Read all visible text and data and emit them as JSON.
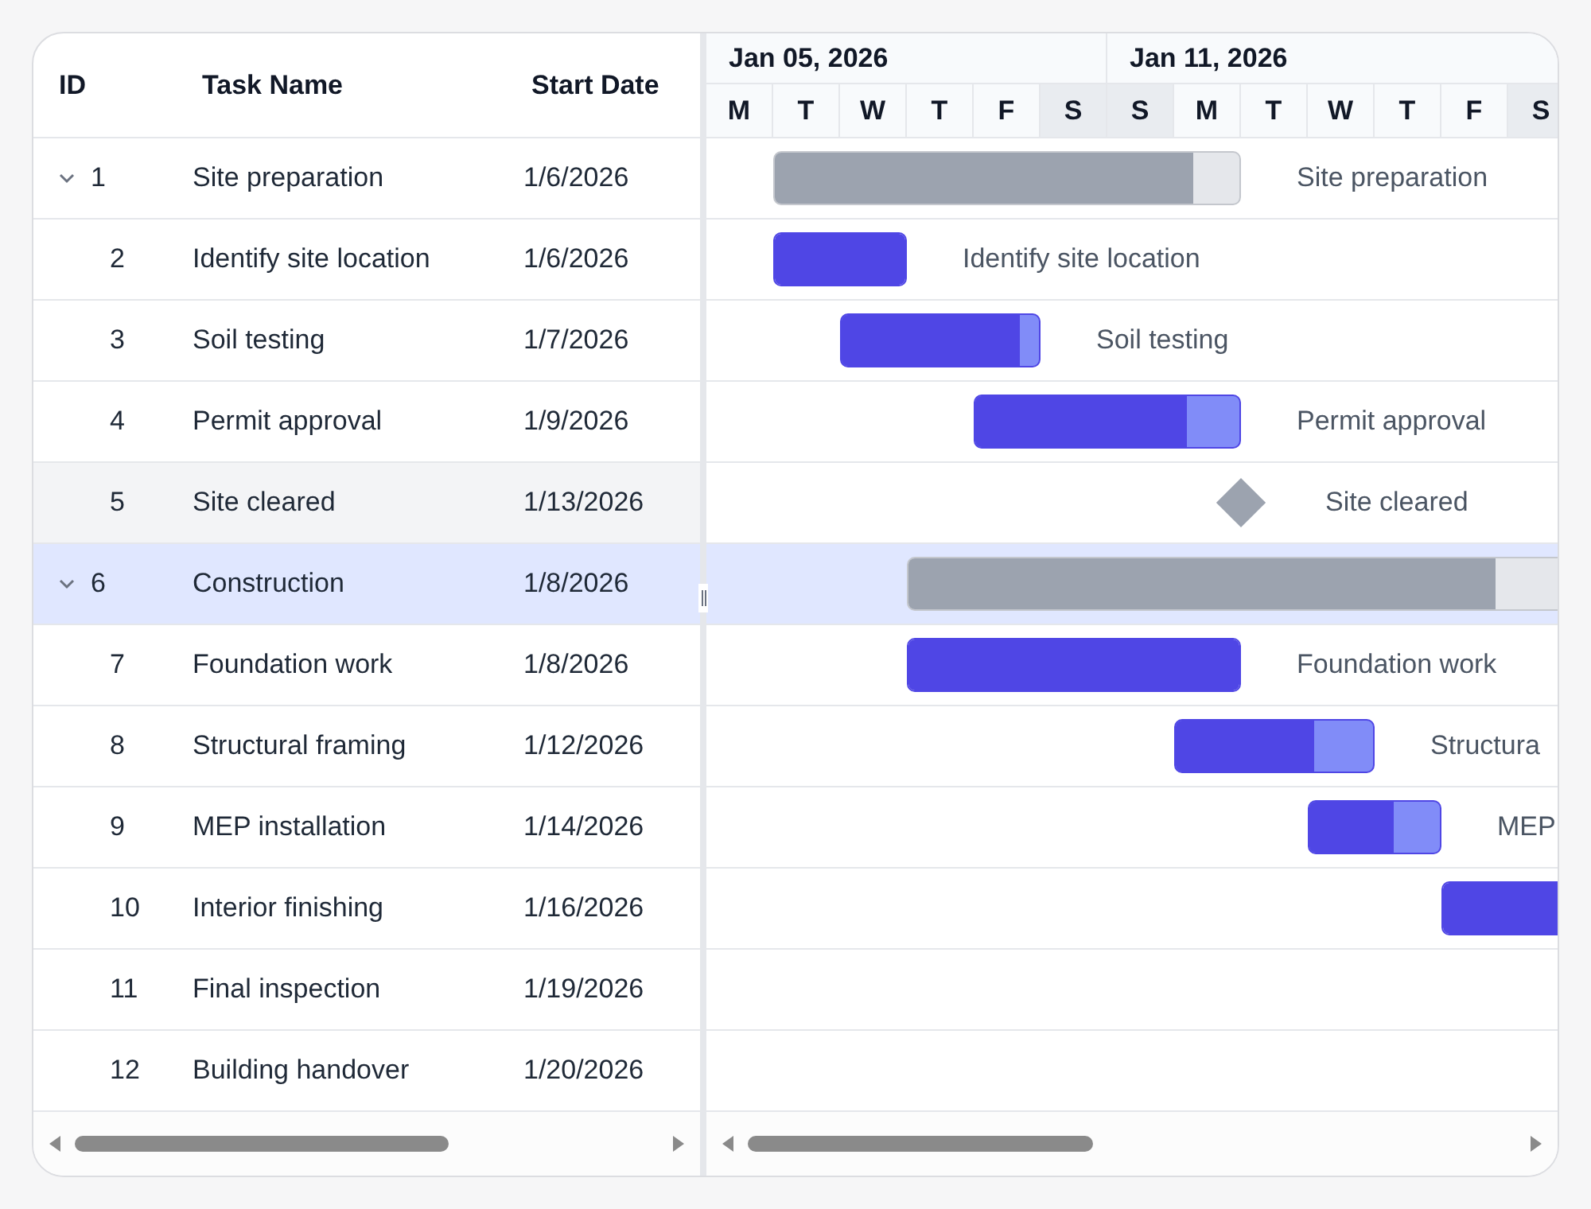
{
  "grid": {
    "columns": [
      {
        "label": "ID"
      },
      {
        "label": "Task Name"
      },
      {
        "label": "Start Date"
      }
    ]
  },
  "timeline": {
    "weeks": [
      {
        "label": "Jan 05, 2026"
      },
      {
        "label": "Jan 11, 2026"
      }
    ],
    "days": [
      {
        "label": "M",
        "weekend": false
      },
      {
        "label": "T",
        "weekend": false
      },
      {
        "label": "W",
        "weekend": false
      },
      {
        "label": "T",
        "weekend": false
      },
      {
        "label": "F",
        "weekend": false
      },
      {
        "label": "S",
        "weekend": true
      },
      {
        "label": "S",
        "weekend": true
      },
      {
        "label": "M",
        "weekend": false
      },
      {
        "label": "T",
        "weekend": false
      },
      {
        "label": "W",
        "weekend": false
      },
      {
        "label": "T",
        "weekend": false
      },
      {
        "label": "F",
        "weekend": false
      },
      {
        "label": "S",
        "weekend": true
      }
    ]
  },
  "tasks": [
    {
      "id": "1",
      "name": "Site preparation",
      "start": "1/6/2026",
      "expanded": true,
      "selected": false,
      "hovered": false,
      "bar": {
        "kind": "summary",
        "level": 0.9,
        "label": "Site preparation"
      },
      "children": [
        {
          "id": "2",
          "name": "Identify site location",
          "start": "1/6/2026",
          "selected": false,
          "hovered": false,
          "bar": {
            "kind": "task",
            "level": 1,
            "label": "Identify site location"
          }
        },
        {
          "id": "3",
          "name": "Soil testing",
          "start": "1/7/2026",
          "selected": false,
          "hovered": false,
          "bar": {
            "kind": "task",
            "level": 0.9,
            "label": "Soil testing"
          }
        },
        {
          "id": "4",
          "name": "Permit approval",
          "start": "1/9/2026",
          "selected": false,
          "hovered": false,
          "bar": {
            "kind": "task",
            "level": 0.8,
            "label": "Permit approval"
          }
        },
        {
          "id": "5",
          "name": "Site cleared",
          "start": "1/13/2026",
          "selected": false,
          "hovered": true,
          "bar": {
            "kind": "milestone",
            "label": "Site cleared"
          }
        }
      ]
    },
    {
      "id": "6",
      "name": "Construction",
      "start": "1/8/2026",
      "expanded": true,
      "selected": true,
      "hovered": false,
      "bar": {
        "kind": "summary",
        "level": 0.63
      },
      "children": [
        {
          "id": "7",
          "name": "Foundation work",
          "start": "1/8/2026",
          "selected": false,
          "hovered": false,
          "bar": {
            "kind": "task",
            "level": 1,
            "label": "Foundation work"
          }
        },
        {
          "id": "8",
          "name": "Structural framing",
          "start": "1/12/2026",
          "selected": false,
          "hovered": false,
          "bar": {
            "kind": "task",
            "level": 0.7,
            "label": "Structura"
          }
        },
        {
          "id": "9",
          "name": "MEP installation",
          "start": "1/14/2026",
          "selected": false,
          "hovered": false,
          "bar": {
            "kind": "task",
            "level": 0.65,
            "label": "MEP"
          }
        },
        {
          "id": "10",
          "name": "Interior finishing",
          "start": "1/16/2026",
          "selected": false,
          "hovered": false,
          "bar": {
            "kind": "task",
            "level": 1
          }
        },
        {
          "id": "11",
          "name": "Final inspection",
          "start": "1/19/2026",
          "selected": false,
          "hovered": false
        },
        {
          "id": "12",
          "name": "Building handover",
          "start": "1/20/2026",
          "selected": false,
          "hovered": false
        }
      ]
    }
  ]
}
